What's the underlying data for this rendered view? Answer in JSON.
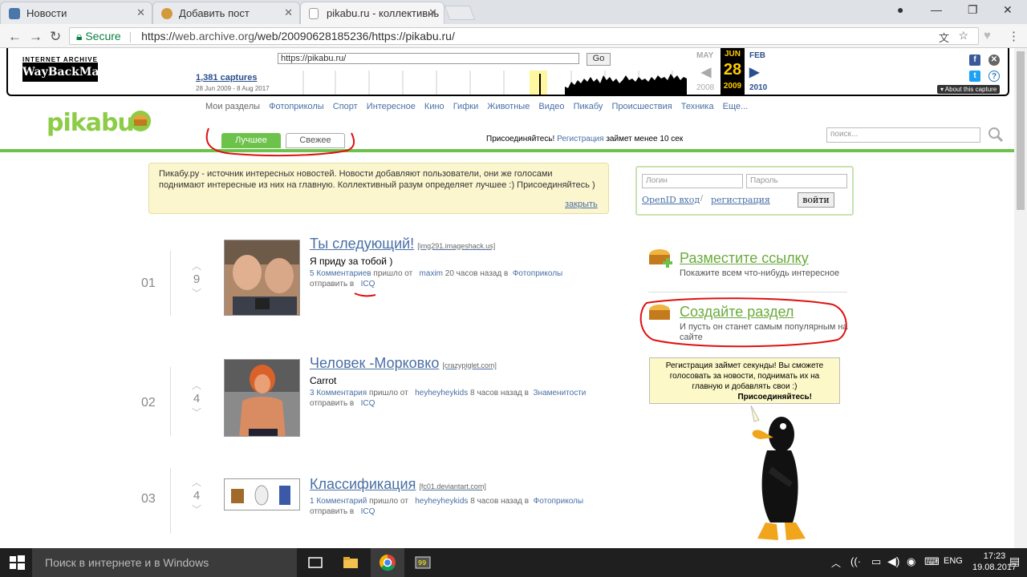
{
  "browser": {
    "tabs": [
      {
        "title": "Новости",
        "icon": "vk-icon"
      },
      {
        "title": "Добавить пост",
        "icon": "pikabu-icon"
      },
      {
        "title": "pikabu.ru - коллективнь",
        "icon": "page-icon"
      }
    ],
    "secure_label": "Secure",
    "url_prefix": "https://",
    "url_host": "web.archive.org",
    "url_rest": "/web/20090628185236/https://pikabu.ru/"
  },
  "wayback": {
    "logo_top": "INTERNET ARCHIVE",
    "logo": "WayBackMachine",
    "url_value": "https://pikabu.ru/",
    "go_label": "Go",
    "captures": "1,381 captures",
    "range": "28 Jun 2009 - 8 Aug 2017",
    "prev_month": "MAY",
    "cur_month": "JUN",
    "next_month": "FEB",
    "cur_day": "28",
    "prev_year": "2008",
    "cur_year": "2009",
    "next_year": "2010",
    "about": "▾ About this capture"
  },
  "pikabu": {
    "logo": "pikabu",
    "menu_label": "Мои разделы",
    "menu": [
      "Фотоприколы",
      "Спорт",
      "Интересное",
      "Кино",
      "Гифки",
      "Животные",
      "Видео",
      "Пикабу",
      "Происшествия",
      "Техника",
      "Еще..."
    ],
    "tab_best": "Лучшее",
    "tab_fresh": "Свежее",
    "join_prefix": "Присоединяйтесь!",
    "join_link": "Регистрация",
    "join_suffix": "займет менее 10 сек",
    "search_placeholder": "поиск..."
  },
  "info": {
    "text": "Пикабу.ру - источник интересных новостей. Новости добавляют пользователи, они же голосами поднимают интересные из них на главную. Коллективный разум определяет лучшее :) Присоединяйтесь )",
    "close": "закрыть"
  },
  "login": {
    "login_placeholder": "Логин",
    "password_placeholder": "Пароль",
    "openid": "OpenID вход",
    "separator": "/",
    "register": "регистрация",
    "submit": "войти"
  },
  "posts": [
    {
      "num": "01",
      "votes": "9",
      "title": "Ты следующий!",
      "domain": "[img291.imageshack.us]",
      "desc": "Я приду за тобой )",
      "comments": "5 Комментариев",
      "came": "пришло от",
      "author": "maxim",
      "time": "20 часов назад в",
      "category": "Фотоприколы",
      "send": "отправить в",
      "send_target": "ICQ"
    },
    {
      "num": "02",
      "votes": "4",
      "title": "Человек -Морковко",
      "domain": "[crazypiglet.com]",
      "desc": "Carrot",
      "comments": "3 Комментария",
      "came": "пришло от",
      "author": "heyheyheykids",
      "time": "8 часов назад в",
      "category": "Знаменитости",
      "send": "отправить в",
      "send_target": "ICQ"
    },
    {
      "num": "03",
      "votes": "4",
      "title": "Классификация",
      "domain": "[fc01.deviantart.com]",
      "desc": "",
      "comments": "1 Комментарий",
      "came": "пришло от",
      "author": "heyheyheykids",
      "time": "8 часов назад в",
      "category": "Фотоприколы",
      "send": "отправить в",
      "send_target": "ICQ"
    }
  ],
  "right": {
    "promo1_title": "Разместите ссылку",
    "promo1_sub": "Покажите всем что-нибудь интересное",
    "promo2_title": "Создайте раздел",
    "promo2_sub": "И пусть он станет самым популярным на сайте",
    "bubble_text": "Регистрация займет секунды! Вы сможете голосовать за новости, поднимать их на главную и добавлять свои :)",
    "bubble_bold": "Присоединяйтесь!"
  },
  "taskbar": {
    "search": "Поиск в интернете и в Windows",
    "lang": "ENG",
    "time": "17:23",
    "date": "19.08.2017"
  },
  "colors": {
    "accent_green": "#6cc24a",
    "link_blue": "#4a6fa5",
    "annotation_red": "#e01010"
  }
}
